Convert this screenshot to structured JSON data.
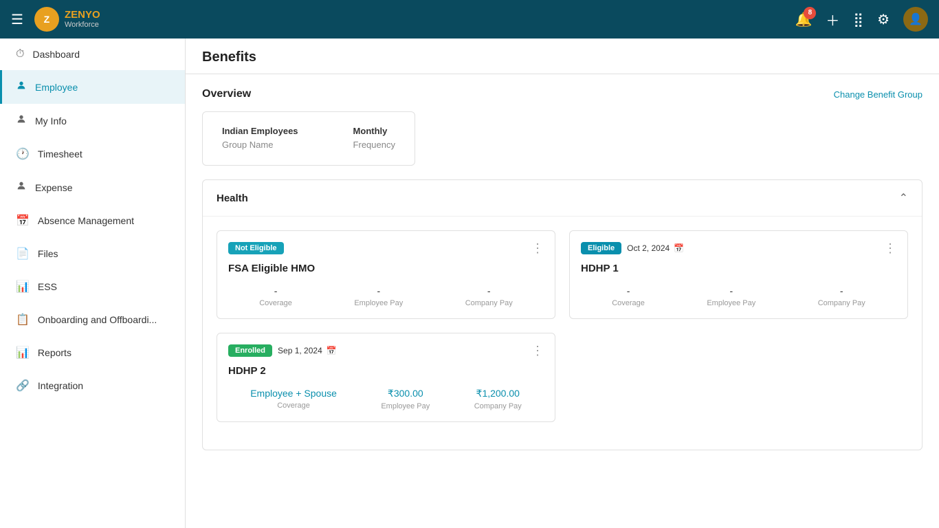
{
  "app": {
    "name": "ZENYO",
    "subtitle": "Workforce",
    "notification_count": "8"
  },
  "sidebar": {
    "items": [
      {
        "id": "dashboard",
        "label": "Dashboard",
        "icon": "⏱"
      },
      {
        "id": "employee",
        "label": "Employee",
        "icon": "👤",
        "active": true
      },
      {
        "id": "myinfo",
        "label": "My Info",
        "icon": "👤"
      },
      {
        "id": "timesheet",
        "label": "Timesheet",
        "icon": "🕐"
      },
      {
        "id": "expense",
        "label": "Expense",
        "icon": "👤"
      },
      {
        "id": "absence",
        "label": "Absence Management",
        "icon": "📅"
      },
      {
        "id": "files",
        "label": "Files",
        "icon": "📄"
      },
      {
        "id": "ess",
        "label": "ESS",
        "icon": "📊"
      },
      {
        "id": "onboarding",
        "label": "Onboarding and Offboardi...",
        "icon": "📋"
      },
      {
        "id": "reports",
        "label": "Reports",
        "icon": "📊"
      },
      {
        "id": "integration",
        "label": "Integration",
        "icon": "🔗"
      }
    ]
  },
  "page": {
    "title": "Benefits"
  },
  "overview": {
    "section_title": "Overview",
    "change_link": "Change Benefit Group",
    "group_name_label": "Indian Employees",
    "group_name_sub": "Group Name",
    "frequency_label": "Monthly",
    "frequency_sub": "Frequency"
  },
  "health": {
    "section_title": "Health",
    "cards": [
      {
        "id": "fsa-hmo",
        "badge": "Not Eligible",
        "badge_type": "not-eligible",
        "date": null,
        "name": "FSA Eligible HMO",
        "coverage": "-",
        "employee_pay": "-",
        "company_pay": "-",
        "coverage_label": "Coverage",
        "employee_pay_label": "Employee Pay",
        "company_pay_label": "Company Pay"
      },
      {
        "id": "hdhp1",
        "badge": "Eligible",
        "badge_type": "eligible",
        "date": "Oct 2, 2024",
        "name": "HDHP 1",
        "coverage": "-",
        "employee_pay": "-",
        "company_pay": "-",
        "coverage_label": "Coverage",
        "employee_pay_label": "Employee Pay",
        "company_pay_label": "Company Pay"
      }
    ],
    "enrolled_card": {
      "badge": "Enrolled",
      "badge_type": "enrolled",
      "date": "Sep 1, 2024",
      "name": "HDHP 2",
      "coverage": "Employee + Spouse",
      "employee_pay": "₹300.00",
      "company_pay": "₹1,200.00",
      "coverage_label": "Coverage",
      "employee_pay_label": "Employee Pay",
      "company_pay_label": "Company Pay"
    }
  }
}
